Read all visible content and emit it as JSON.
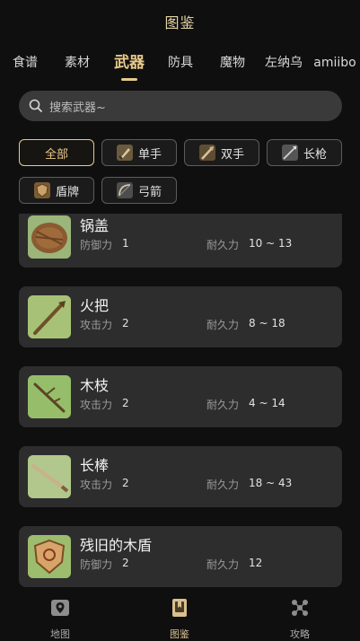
{
  "header": {
    "title": "图鉴"
  },
  "tabs": [
    {
      "label": "食谱"
    },
    {
      "label": "素材"
    },
    {
      "label": "武器"
    },
    {
      "label": "防具"
    },
    {
      "label": "魔物"
    },
    {
      "label": "左纳乌"
    },
    {
      "label": "amiibo"
    }
  ],
  "active_tab": "武器",
  "search": {
    "placeholder": "搜索武器~"
  },
  "filters": [
    {
      "label": "全部"
    },
    {
      "label": "单手"
    },
    {
      "label": "双手"
    },
    {
      "label": "长枪"
    },
    {
      "label": "盾牌"
    },
    {
      "label": "弓箭"
    }
  ],
  "active_filter": "全部",
  "items": [
    {
      "name": "锅盖",
      "stat1_label": "防御力",
      "stat1_value": "1",
      "stat2_label": "耐久力",
      "stat2_value": "10 ~ 13"
    },
    {
      "name": "火把",
      "stat1_label": "攻击力",
      "stat1_value": "2",
      "stat2_label": "耐久力",
      "stat2_value": "8 ~ 18"
    },
    {
      "name": "木枝",
      "stat1_label": "攻击力",
      "stat1_value": "2",
      "stat2_label": "耐久力",
      "stat2_value": "4 ~ 14"
    },
    {
      "name": "长棒",
      "stat1_label": "攻击力",
      "stat1_value": "2",
      "stat2_label": "耐久力",
      "stat2_value": "18 ~ 43"
    },
    {
      "name": "残旧的木盾",
      "stat1_label": "防御力",
      "stat1_value": "2",
      "stat2_label": "耐久力",
      "stat2_value": "12"
    }
  ],
  "bottom_nav": [
    {
      "label": "地图",
      "icon": "map-icon"
    },
    {
      "label": "图鉴",
      "icon": "book-icon"
    },
    {
      "label": "攻略",
      "icon": "guide-icon"
    }
  ],
  "colors": {
    "accent": "#e8c98a",
    "card": "#2d2d2d",
    "background": "#0f0f0f"
  }
}
